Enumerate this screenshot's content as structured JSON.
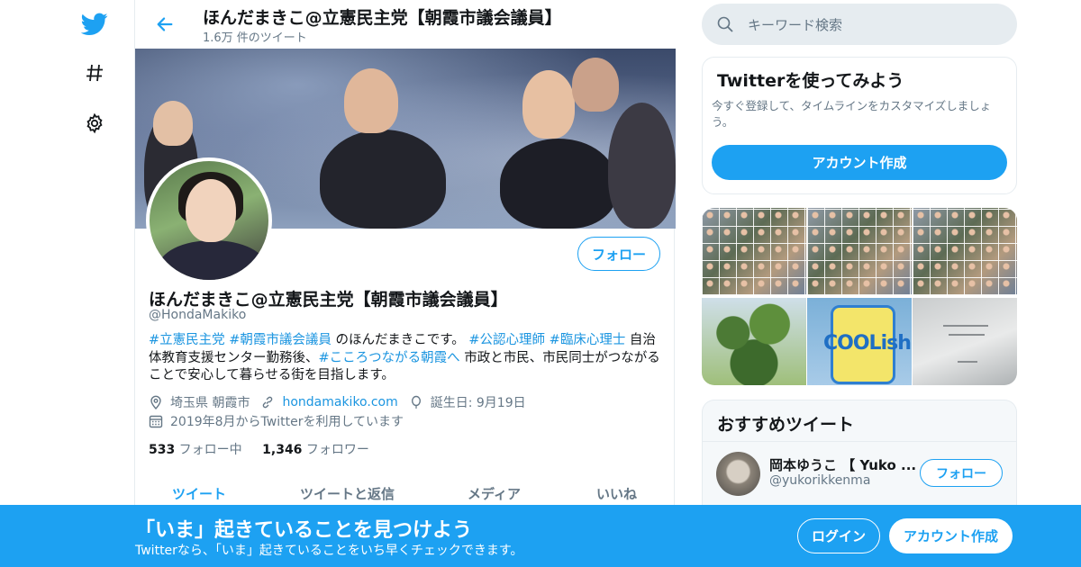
{
  "header": {
    "title": "ほんだまきこ@立憲民主党【朝霞市議会議員】",
    "tweet_count": "1.6万 件のツイート"
  },
  "profile": {
    "follow_label": "フォロー",
    "name": "ほんだまきこ@立憲民主党【朝霞市議会議員】",
    "handle": "@HondaMakiko",
    "bio": {
      "tag1": "#立憲民主党",
      "tag2": "#朝霞市議会議員",
      "text1": " のほんだまきこです。 ",
      "tag3": "#公認心理師",
      "tag4": "#臨床心理士",
      "text2": " 自治体教育支援センター勤務後、",
      "tag5": "#こころつながる朝霞へ",
      "text3": " 市政と市民、市民同士がつながることで安心して暮らせる街を目指します。"
    },
    "location": "埼玉県 朝霞市",
    "website": "hondamakiko.com",
    "birthday": "誕生日: 9月19日",
    "joined": "2019年8月からTwitterを利用しています",
    "following_count": "533",
    "following_label": " フォロー中",
    "followers_count": "1,346",
    "followers_label": " フォロワー"
  },
  "tabs": [
    "ツイート",
    "ツイートと返信",
    "メディア",
    "いいね"
  ],
  "search": {
    "placeholder": "キーワード検索"
  },
  "signup_card": {
    "title": "Twitterを使ってみよう",
    "desc": "今すぐ登録して、タイムラインをカスタマイズしましょう。",
    "button": "アカウント作成"
  },
  "media_thumbs": {
    "ice_logo": "COOLish"
  },
  "recommended": {
    "title": "おすすめツイート",
    "name": "岡本ゆうこ 【 Yuko ...",
    "handle": "@yukorikkenma",
    "follow_label": "フォロー"
  },
  "bottom_bar": {
    "headline": "「いま」起きていることを見つけよう",
    "sub": "Twitterなら、「いま」起きていることをいち早くチェックできます。",
    "login": "ログイン",
    "signup": "アカウント作成"
  },
  "colors": {
    "accent": "#1da1f2",
    "link": "#1b95e0",
    "muted": "#657786"
  },
  "icons": [
    "twitter-logo-icon",
    "hashtag-icon",
    "gear-icon",
    "back-arrow-icon",
    "search-icon",
    "location-icon",
    "link-icon",
    "balloon-icon",
    "calendar-icon"
  ]
}
